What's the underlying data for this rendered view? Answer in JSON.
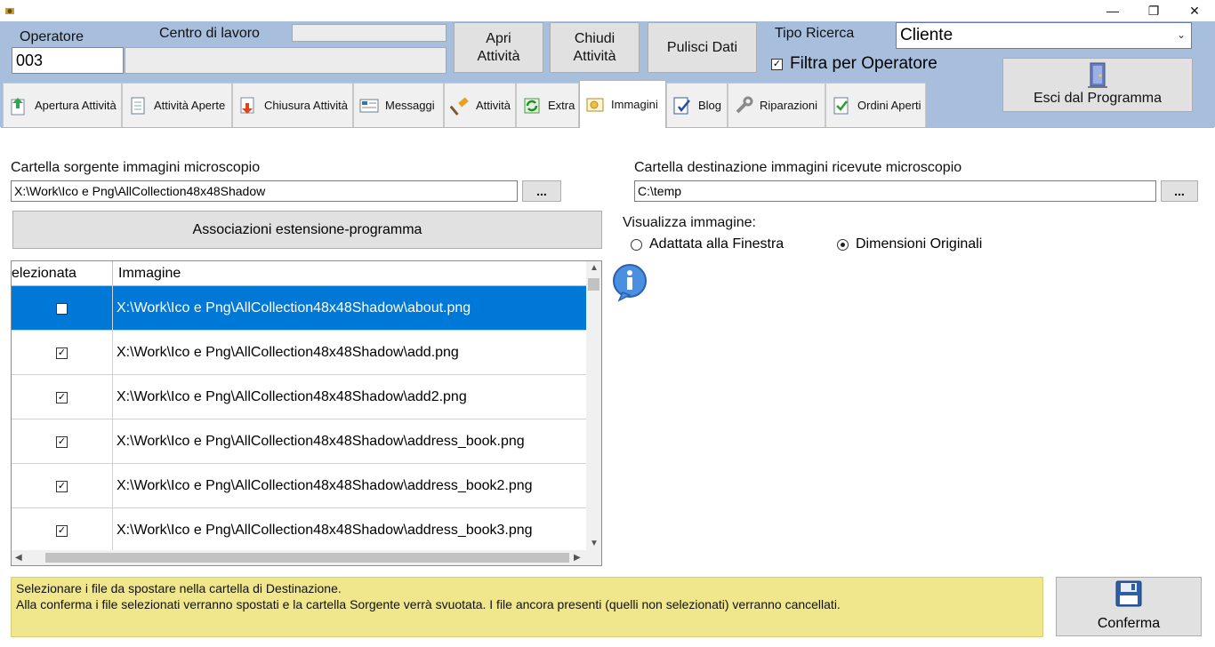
{
  "window": {
    "minimize_glyph": "—",
    "restore_glyph": "❐",
    "close_glyph": "✕"
  },
  "header": {
    "operatore_label": "Operatore",
    "operatore_value": "003",
    "centro_label": "Centro di lavoro",
    "apri_line1": "Apri",
    "apri_line2": "Attività",
    "chiudi_line1": "Chiudi",
    "chiudi_line2": "Attività",
    "pulisci_label": "Pulisci Dati",
    "tipo_ricerca_label": "Tipo Ricerca",
    "tipo_ricerca_value": "Cliente",
    "filtra_label": "Filtra per Operatore",
    "filtra_checked": true,
    "esci_label": "Esci dal Programma"
  },
  "tabs": [
    {
      "label": "Apertura Attività",
      "icon": "upload-icon"
    },
    {
      "label": "Attività Aperte",
      "icon": "document-icon"
    },
    {
      "label": "Chiusura Attività",
      "icon": "download-icon"
    },
    {
      "label": "Messaggi",
      "icon": "message-icon"
    },
    {
      "label": "Attività",
      "icon": "hammer-icon"
    },
    {
      "label": "Extra",
      "icon": "refresh-icon"
    },
    {
      "label": "Immagini",
      "icon": "images-icon",
      "active": true
    },
    {
      "label": "Blog",
      "icon": "blog-icon"
    },
    {
      "label": "Riparazioni",
      "icon": "wrench-icon"
    },
    {
      "label": "Ordini Aperti",
      "icon": "check-doc-icon"
    }
  ],
  "content": {
    "source_label": "Cartella sorgente immagini microscopio",
    "source_value": "X:\\Work\\Ico e Png\\AllCollection48x48Shadow",
    "dest_label": "Cartella destinazione immagini ricevute microscopio",
    "dest_value": "C:\\temp",
    "browse_label": "...",
    "assoc_label": "Associazioni estensione-programma",
    "visualizza_label": "Visualizza immagine:",
    "radio_fit": "Adattata alla Finestra",
    "radio_original": "Dimensioni Originali",
    "selected_radio": "original"
  },
  "grid": {
    "col_selected": "elezionata",
    "col_image": "Immagine",
    "rows": [
      {
        "checked": true,
        "path": "X:\\Work\\Ico e Png\\AllCollection48x48Shadow\\about.png",
        "selected": true
      },
      {
        "checked": true,
        "path": "X:\\Work\\Ico e Png\\AllCollection48x48Shadow\\add.png"
      },
      {
        "checked": true,
        "path": "X:\\Work\\Ico e Png\\AllCollection48x48Shadow\\add2.png"
      },
      {
        "checked": true,
        "path": "X:\\Work\\Ico e Png\\AllCollection48x48Shadow\\address_book.png"
      },
      {
        "checked": true,
        "path": "X:\\Work\\Ico e Png\\AllCollection48x48Shadow\\address_book2.png"
      },
      {
        "checked": true,
        "path": "X:\\Work\\Ico e Png\\AllCollection48x48Shadow\\address_book3.png"
      }
    ]
  },
  "footer": {
    "notice_line1": "Selezionare i file da spostare nella cartella di Destinazione.",
    "notice_line2": "Alla conferma i file selezionati verranno spostati e la cartella Sorgente verrà svuotata. I file ancora presenti (quelli non selezionati) verranno cancellati.",
    "confirm_label": "Conferma"
  },
  "colors": {
    "header_bg": "#a7bfdc",
    "selection": "#0078d7",
    "notice_bg": "#f0e68c"
  }
}
